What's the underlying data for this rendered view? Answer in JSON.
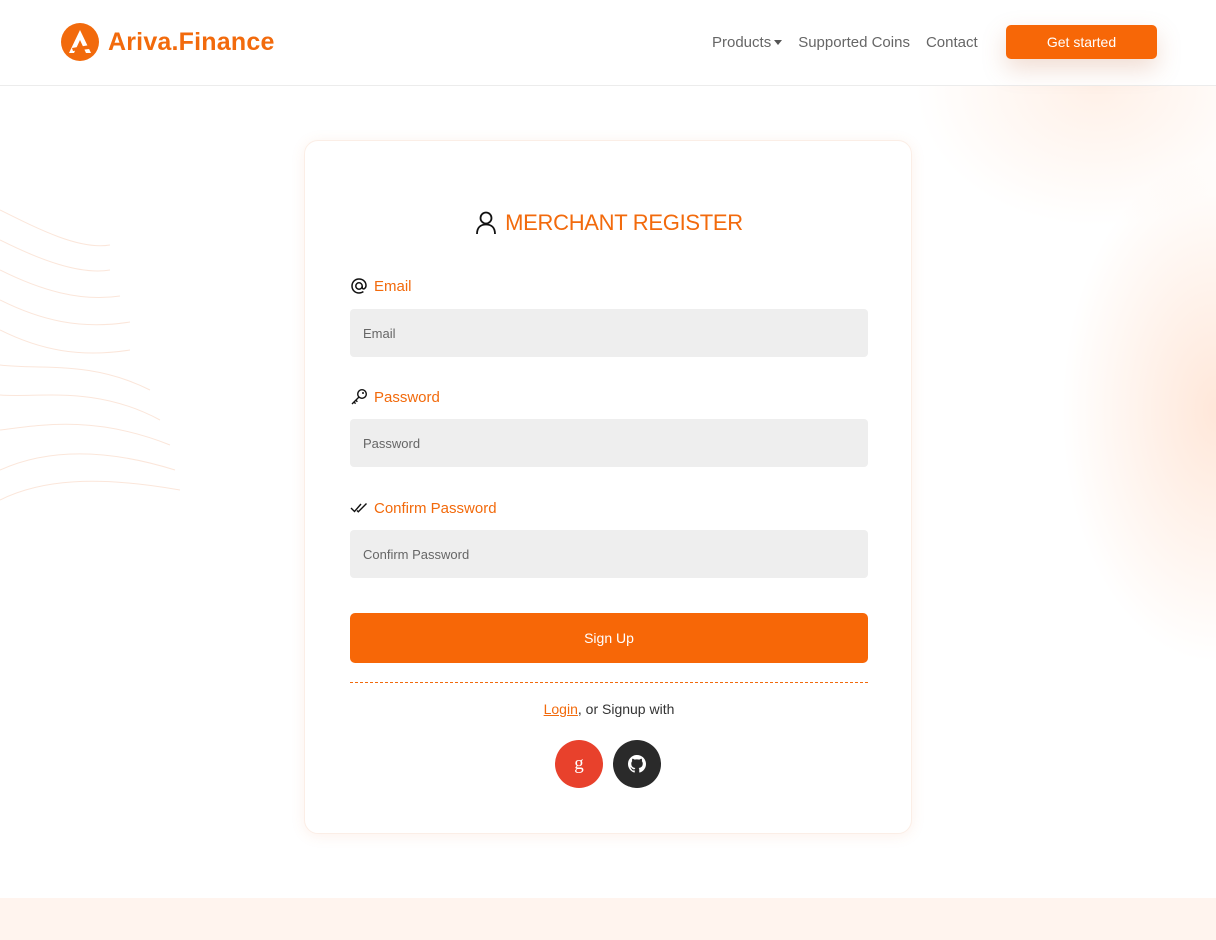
{
  "brand": {
    "name": "Ariva.Finance",
    "accent": "#f26a0c",
    "button_color": "#f76707"
  },
  "nav": {
    "items": [
      {
        "label": "Products",
        "has_dropdown": true
      },
      {
        "label": "Supported Coins"
      },
      {
        "label": "Contact"
      }
    ],
    "cta_label": "Get started"
  },
  "form": {
    "title": "MERCHANT REGISTER",
    "title_icon": "user-icon",
    "fields": {
      "email": {
        "label": "Email",
        "icon": "at-sign-icon",
        "placeholder": "Email",
        "value": ""
      },
      "password": {
        "label": "Password",
        "icon": "key-icon",
        "placeholder": "Password",
        "value": ""
      },
      "confirm": {
        "label": "Confirm Password",
        "icon": "double-check-icon",
        "placeholder": "Confirm Password",
        "value": ""
      }
    },
    "submit_label": "Sign Up",
    "login_link": "Login",
    "alt_text": ", or Signup with",
    "social": [
      {
        "name": "google",
        "glyph": "g",
        "color": "#e8412c"
      },
      {
        "name": "github",
        "icon": "github-icon",
        "color": "#2a2a2a"
      }
    ]
  }
}
